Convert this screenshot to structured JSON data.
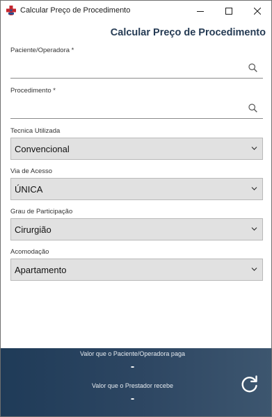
{
  "window": {
    "title": "Calcular Preço de Procedimento"
  },
  "header": {
    "title": "Calcular Preço de Procedimento"
  },
  "form": {
    "paciente": {
      "label": "Paciente/Operadora *",
      "value": "",
      "icon": "search-icon"
    },
    "procedimento": {
      "label": "Procedimento *",
      "value": "",
      "icon": "search-icon"
    },
    "tecnica": {
      "label": "Tecnica Utilizada",
      "selected": "Convencional"
    },
    "via_acesso": {
      "label": "Via de Acesso",
      "selected": "ÚNICA"
    },
    "grau_participacao": {
      "label": "Grau de Participação",
      "selected": "Cirurgião"
    },
    "acomodacao": {
      "label": "Acomodação",
      "selected": "Apartamento"
    }
  },
  "footer": {
    "paciente_label": "Valor que o Paciente/Operadora paga",
    "paciente_value": "-",
    "prestador_label": "Valor que o Prestador recebe",
    "prestador_value": "-",
    "refresh_icon": "refresh-icon"
  },
  "colors": {
    "header_title": "#253b54",
    "footer_start": "#1f3b58",
    "footer_end": "#3d566f",
    "select_bg": "#e1e1e1"
  }
}
